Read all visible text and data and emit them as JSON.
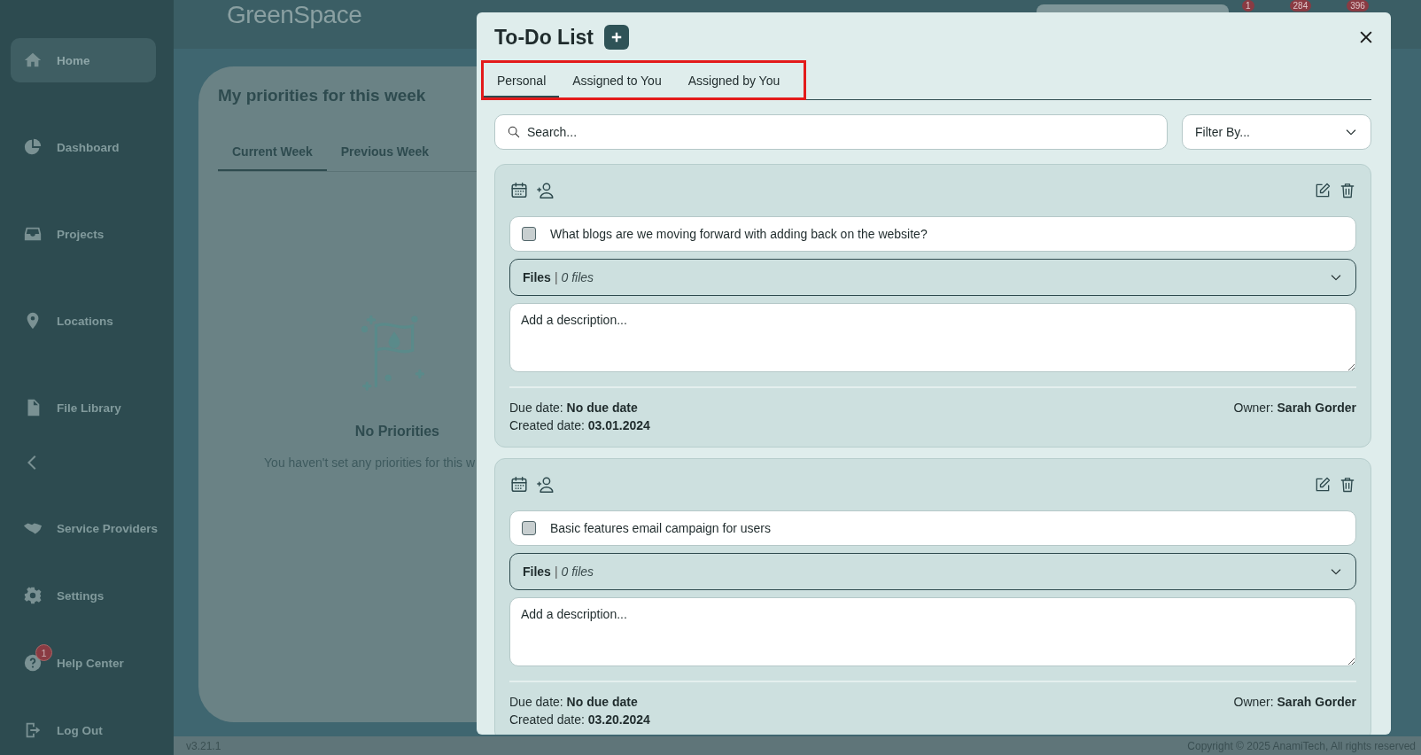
{
  "topbar": {
    "logo": "GreenSpace",
    "badges": [
      "1",
      "284",
      "396"
    ]
  },
  "sidebar": {
    "items_top": [
      {
        "label": "Home",
        "selected": true
      },
      {
        "label": "Dashboard",
        "selected": false
      },
      {
        "label": "Projects",
        "selected": false
      },
      {
        "label": "Locations",
        "selected": false
      },
      {
        "label": "File Library",
        "selected": false
      }
    ],
    "items_bottom": [
      {
        "label": "Service Providers",
        "selected": false
      },
      {
        "label": "Settings",
        "selected": false
      },
      {
        "label": "Help Center",
        "selected": false,
        "badge": "1"
      },
      {
        "label": "Log Out",
        "selected": false
      }
    ]
  },
  "priorities": {
    "title": "My priorities for this week",
    "tabs": [
      {
        "label": "Current Week",
        "selected": true
      },
      {
        "label": "Previous Week",
        "selected": false
      }
    ],
    "empty_title": "No Priorities",
    "empty_text": "You haven't set any priorities for this w"
  },
  "footer": {
    "version": "v3.21.1",
    "copyright": "Copyright © 2025 AnamiTech, All rights reserved"
  },
  "todo_modal": {
    "title": "To-Do List",
    "tabs": [
      {
        "label": "Personal",
        "selected": true
      },
      {
        "label": "Assigned to You",
        "selected": false
      },
      {
        "label": "Assigned by You",
        "selected": false
      }
    ],
    "search": {
      "placeholder": "Search..."
    },
    "filter": {
      "value": "Filter By..."
    },
    "tasks": [
      {
        "checked": false,
        "title": "What blogs are we moving forward with adding back on the website?",
        "files_label": "Files",
        "files_separator": "|",
        "files_count": "0 files",
        "description": {
          "placeholder": "Add a description..."
        },
        "due": "Due date: **No due date**",
        "created": "Created date: **03.01.2024**",
        "owner": "Owner: **Sarah Gorder**"
      },
      {
        "checked": false,
        "title": "Basic features email campaign for users",
        "files_label": "Files",
        "files_separator": "|",
        "files_count": "0 files",
        "description": {
          "placeholder": "Add a description..."
        },
        "due": "Due date: **No due date**",
        "created": "Created date: **03.20.2024**",
        "owner": "Owner: **Sarah Gorder**"
      }
    ]
  }
}
